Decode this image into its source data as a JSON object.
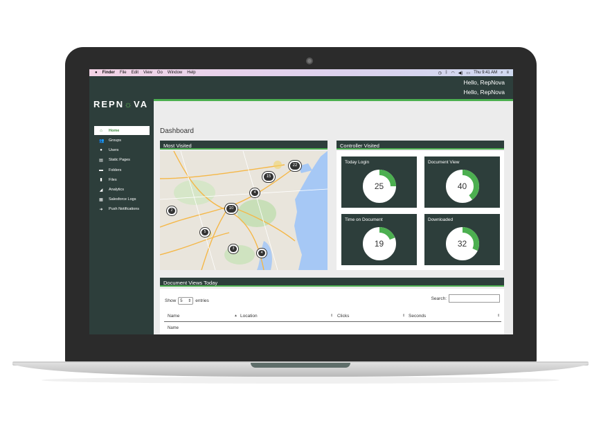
{
  "menubar": {
    "apple": "",
    "app": "Finder",
    "items": [
      "File",
      "Edit",
      "View",
      "Go",
      "Window",
      "Help"
    ],
    "clock": "Thu 9:41 AM"
  },
  "header": {
    "greeting_1": "Hello, RepNova",
    "greeting_2": "Hello, RepNova"
  },
  "logo": {
    "pre": "REPN",
    "o": "☼",
    "post": "VA"
  },
  "sidebar": {
    "items": [
      {
        "label": "Home",
        "icon": "home-icon",
        "glyph": "⌂"
      },
      {
        "label": "Groups",
        "icon": "groups-icon",
        "glyph": "👥"
      },
      {
        "label": "Users",
        "icon": "user-icon",
        "glyph": "●"
      },
      {
        "label": "Static Pages",
        "icon": "page-icon",
        "glyph": "▤"
      },
      {
        "label": "Folders",
        "icon": "folder-icon",
        "glyph": "▬"
      },
      {
        "label": "Files",
        "icon": "file-icon",
        "glyph": "▮"
      },
      {
        "label": "Analytics",
        "icon": "analytics-icon",
        "glyph": "◢"
      },
      {
        "label": "Salesforce Logs",
        "icon": "log-icon",
        "glyph": "▦"
      },
      {
        "label": "Push Notifications",
        "icon": "push-icon",
        "glyph": "➜"
      }
    ]
  },
  "page_title": "Dashboard",
  "most_visited": {
    "title": "Most Visited",
    "clusters": [
      "22",
      "15",
      "4",
      "10",
      "2",
      "5",
      "3",
      "4"
    ]
  },
  "controller": {
    "title": "Controller Visited",
    "cards": [
      {
        "title": "Today Login",
        "value": "25",
        "fraction": 0.25
      },
      {
        "title": "Document View",
        "value": "40",
        "fraction": 0.4
      },
      {
        "title": "Time on Document",
        "value": "19",
        "fraction": 0.19
      },
      {
        "title": "Downloaded",
        "value": "32",
        "fraction": 0.32
      }
    ]
  },
  "doc_views": {
    "title": "Document Views Today",
    "show_label": "Show",
    "entries_value": "5",
    "entries_label": "entries",
    "search_label": "Search:",
    "columns": [
      "Name",
      "Location",
      "Clicks",
      "Seconds"
    ],
    "first_row": "Name"
  },
  "colors": {
    "panel": "#2d3e3b",
    "accent": "#4caf50"
  }
}
